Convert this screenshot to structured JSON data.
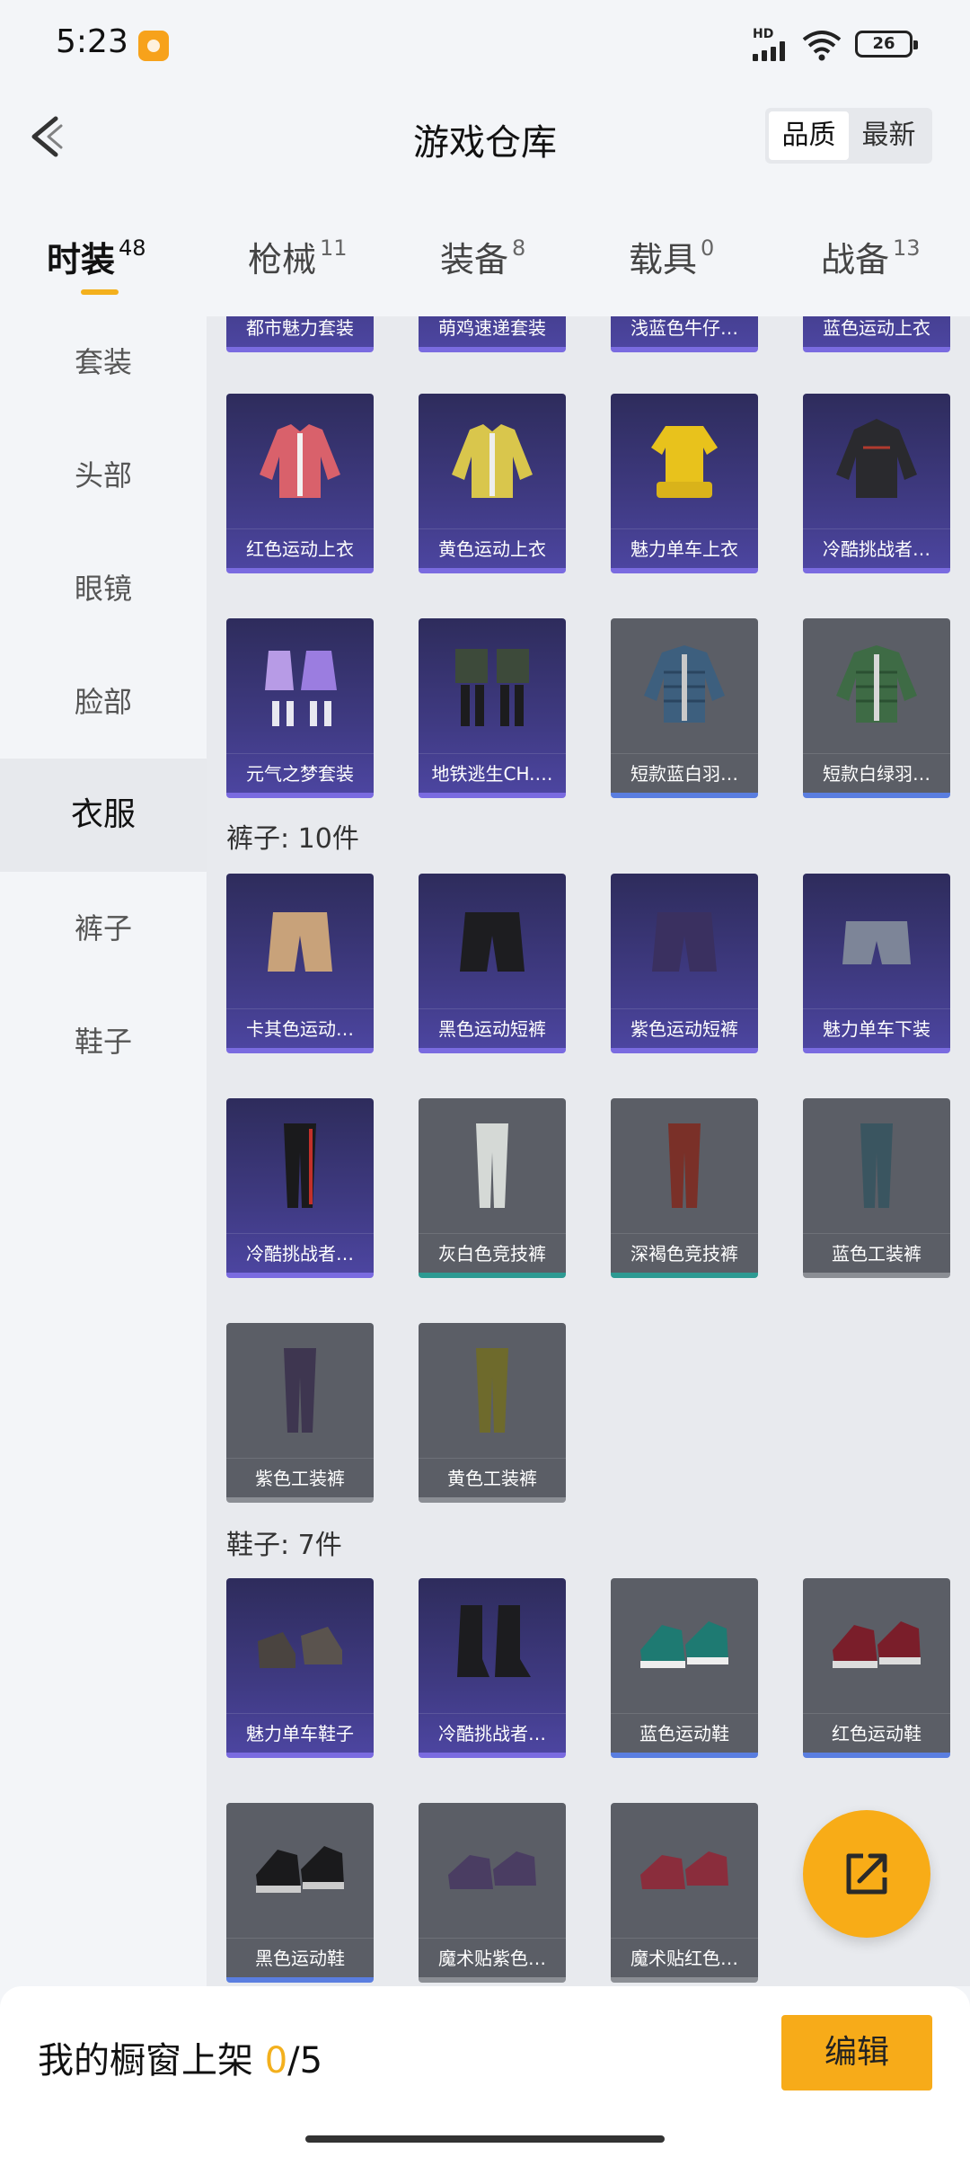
{
  "status_bar": {
    "time": "5:23",
    "network": "HD",
    "battery": "26"
  },
  "header": {
    "title": "游戏仓库",
    "sort_options": [
      "品质",
      "最新"
    ],
    "sort_active": "品质"
  },
  "tabs": [
    {
      "label": "时装",
      "count": "48",
      "active": true
    },
    {
      "label": "枪械",
      "count": "11"
    },
    {
      "label": "装备",
      "count": "8"
    },
    {
      "label": "载具",
      "count": "0"
    },
    {
      "label": "战备",
      "count": "13"
    }
  ],
  "sidebar": [
    {
      "label": "套装"
    },
    {
      "label": "头部"
    },
    {
      "label": "眼镜"
    },
    {
      "label": "脸部"
    },
    {
      "label": "衣服",
      "active": true
    },
    {
      "label": "裤子"
    },
    {
      "label": "鞋子"
    }
  ],
  "content": {
    "top_partial": [
      "都市魅力套装",
      "萌鸡速递套装",
      "浅蓝色牛仔…",
      "蓝色运动上衣"
    ],
    "clothes_rows": [
      [
        "红色运动上衣",
        "黄色运动上衣",
        "魅力单车上衣",
        "冷酷挑战者…"
      ],
      [
        "元气之梦套装",
        "地铁逃生CH.…",
        "短款蓝白羽…",
        "短款白绿羽…"
      ]
    ],
    "pants_title": "裤子: 10件",
    "pants": [
      "卡其色运动…",
      "黑色运动短裤",
      "紫色运动短裤",
      "魅力单车下装",
      "冷酷挑战者…",
      "灰白色竞技裤",
      "深褐色竞技裤",
      "蓝色工装裤",
      "紫色工装裤",
      "黄色工装裤"
    ],
    "shoes_title": "鞋子: 7件",
    "shoes": [
      "魅力单车鞋子",
      "冷酷挑战者…",
      "蓝色运动鞋",
      "红色运动鞋",
      "黑色运动鞋",
      "魔术贴紫色…",
      "魔术贴红色…"
    ]
  },
  "bottom_bar": {
    "label": "我的橱窗上架",
    "current": "0",
    "total": "/5",
    "edit": "编辑"
  },
  "colors": {
    "accent": "#f7ab19",
    "purple_card": "#3f3a82",
    "gray_card": "#5b5e66"
  }
}
